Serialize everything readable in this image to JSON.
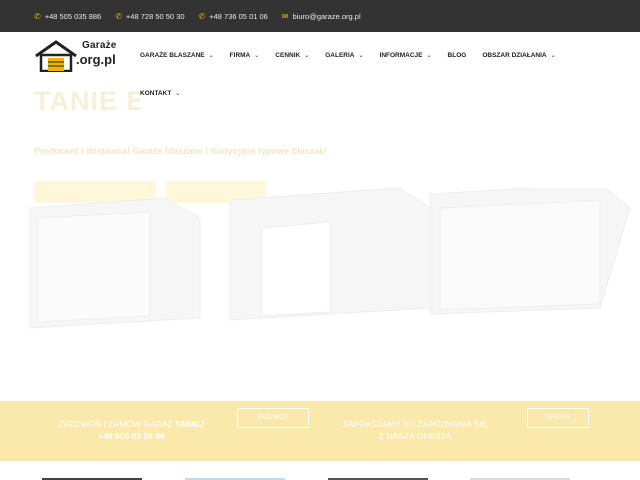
{
  "topbar": {
    "contacts": [
      {
        "icon": "phone-icon",
        "text": "+48 505 035 886"
      },
      {
        "icon": "phone-icon",
        "text": "+48 728 50 50 30"
      },
      {
        "icon": "phone-icon",
        "text": "+48 736 05 01 06"
      },
      {
        "icon": "mail-icon",
        "text": "biuro@garaze.org.pl"
      }
    ]
  },
  "logo": {
    "line1": "Garaże",
    "line2": ".org.pl"
  },
  "nav": {
    "items": [
      {
        "label": "GARAŻE BLASZANE",
        "dropdown": true
      },
      {
        "label": "FIRMA",
        "dropdown": true
      },
      {
        "label": "CENNIK",
        "dropdown": true
      },
      {
        "label": "GALERIA",
        "dropdown": true
      },
      {
        "label": "INFORMACJE",
        "dropdown": true
      },
      {
        "label": "BLOG",
        "dropdown": false
      },
      {
        "label": "OBSZAR DZIAŁANIA",
        "dropdown": true
      }
    ],
    "row2": [
      {
        "label": "KONTAKT",
        "dropdown": true
      }
    ]
  },
  "hero": {
    "title": "TANIE B",
    "subtitle": "Producent i dostawca! Garaże blaszane i tradycyjne typowe blaszak!"
  },
  "cta": {
    "left_text": "ZADZWOŃ I ZAMÓW GARAŻ",
    "left_bold": "TANIEJ",
    "left_phone": "+48 505 03 58 86",
    "left_button": "ZADZWOŃ",
    "right_line1": "ZAPRASZAMY DO ZAPOZNANIA SIĘ",
    "right_line2": "Z NASZĄ OFERTĄ",
    "right_button": "OFERTA"
  },
  "colors": {
    "topbar_bg": "#333333",
    "accent": "#f0b500",
    "cta_bg": "#fbe8ab"
  }
}
